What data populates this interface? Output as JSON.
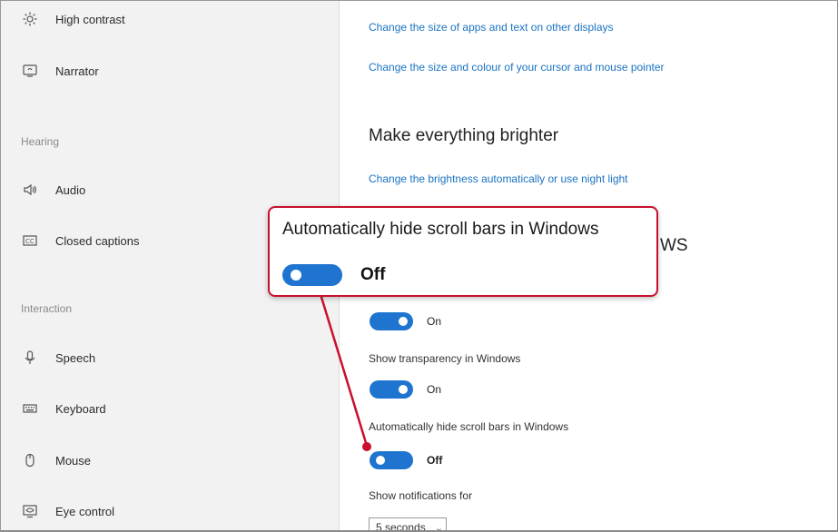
{
  "sidebar": {
    "items_top": [
      {
        "label": "High contrast",
        "icon": "sun-icon"
      },
      {
        "label": "Narrator",
        "icon": "narrator-icon"
      }
    ],
    "section_hearing": "Hearing",
    "items_hearing": [
      {
        "label": "Audio",
        "icon": "speaker-icon"
      },
      {
        "label": "Closed captions",
        "icon": "captions-icon"
      }
    ],
    "section_interaction": "Interaction",
    "items_interaction": [
      {
        "label": "Speech",
        "icon": "microphone-icon"
      },
      {
        "label": "Keyboard",
        "icon": "keyboard-icon"
      },
      {
        "label": "Mouse",
        "icon": "mouse-icon"
      },
      {
        "label": "Eye control",
        "icon": "eye-control-icon"
      }
    ]
  },
  "main": {
    "link_other_displays": "Change the size of apps and text on other displays",
    "link_cursor": "Change the size and colour of your cursor and mouse pointer",
    "heading_brighter": "Make everything brighter",
    "link_brightness": "Change the brightness automatically or use night light",
    "heading_partial_tail": "WS",
    "toggle1_state": "On",
    "transparency_label": "Show transparency in Windows",
    "toggle2_state": "On",
    "scrollbars_label": "Automatically hide scroll bars in Windows",
    "toggle3_state": "Off",
    "notifications_label": "Show notifications for",
    "notifications_value": "5 seconds"
  },
  "callout": {
    "title": "Automatically hide scroll bars in Windows",
    "toggle_state": "Off"
  },
  "colors": {
    "accent": "#1f74d0",
    "link": "#1a73c2",
    "callout_border": "#c8102e"
  }
}
